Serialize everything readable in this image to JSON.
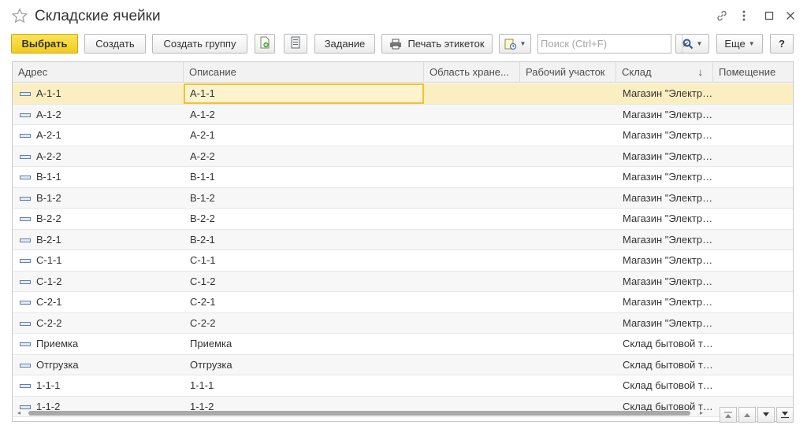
{
  "window": {
    "title": "Складские ячейки"
  },
  "toolbar": {
    "select_label": "Выбрать",
    "create_label": "Создать",
    "create_group_label": "Создать группу",
    "task_label": "Задание",
    "print_labels_label": "Печать этикеток",
    "more_label": "Еще",
    "help_label": "?"
  },
  "search": {
    "placeholder": "Поиск (Ctrl+F)",
    "value": ""
  },
  "table": {
    "columns": [
      {
        "label": "Адрес"
      },
      {
        "label": "Описание"
      },
      {
        "label": "Область хране..."
      },
      {
        "label": "Рабочий участок"
      },
      {
        "label": "Склад"
      },
      {
        "label": "Помещение"
      }
    ],
    "sort_indicator": "↓",
    "rows": [
      {
        "address": "A-1-1",
        "description": "A-1-1",
        "storage_area": "",
        "work_area": "",
        "warehouse": "Магазин \"Электромир\"",
        "room": ""
      },
      {
        "address": "A-1-2",
        "description": "A-1-2",
        "storage_area": "",
        "work_area": "",
        "warehouse": "Магазин \"Электромир\"",
        "room": ""
      },
      {
        "address": "A-2-1",
        "description": "A-2-1",
        "storage_area": "",
        "work_area": "",
        "warehouse": "Магазин \"Электромир\"",
        "room": ""
      },
      {
        "address": "A-2-2",
        "description": "A-2-2",
        "storage_area": "",
        "work_area": "",
        "warehouse": "Магазин \"Электромир\"",
        "room": ""
      },
      {
        "address": "B-1-1",
        "description": "B-1-1",
        "storage_area": "",
        "work_area": "",
        "warehouse": "Магазин \"Электромир\"",
        "room": ""
      },
      {
        "address": "B-1-2",
        "description": "B-1-2",
        "storage_area": "",
        "work_area": "",
        "warehouse": "Магазин \"Электромир\"",
        "room": ""
      },
      {
        "address": "B-2-2",
        "description": "B-2-2",
        "storage_area": "",
        "work_area": "",
        "warehouse": "Магазин \"Электромир\"",
        "room": ""
      },
      {
        "address": "B-2-1",
        "description": "B-2-1",
        "storage_area": "",
        "work_area": "",
        "warehouse": "Магазин \"Электромир\"",
        "room": ""
      },
      {
        "address": "C-1-1",
        "description": "C-1-1",
        "storage_area": "",
        "work_area": "",
        "warehouse": "Магазин \"Электромир\"",
        "room": ""
      },
      {
        "address": "C-1-2",
        "description": "C-1-2",
        "storage_area": "",
        "work_area": "",
        "warehouse": "Магазин \"Электромир\"",
        "room": ""
      },
      {
        "address": "C-2-1",
        "description": "C-2-1",
        "storage_area": "",
        "work_area": "",
        "warehouse": "Магазин \"Электромир\"",
        "room": ""
      },
      {
        "address": "C-2-2",
        "description": "C-2-2",
        "storage_area": "",
        "work_area": "",
        "warehouse": "Магазин \"Электромир\"",
        "room": ""
      },
      {
        "address": "Приемка",
        "description": "Приемка",
        "storage_area": "",
        "work_area": "",
        "warehouse": "Склад бытовой техники",
        "room": ""
      },
      {
        "address": "Отгрузка",
        "description": "Отгрузка",
        "storage_area": "",
        "work_area": "",
        "warehouse": "Склад бытовой техники",
        "room": ""
      },
      {
        "address": "1-1-1",
        "description": "1-1-1",
        "storage_area": "",
        "work_area": "",
        "warehouse": "Склад бытовой техники",
        "room": ""
      },
      {
        "address": "1-1-2",
        "description": "1-1-2",
        "storage_area": "",
        "work_area": "",
        "warehouse": "Склад бытовой техники",
        "room": ""
      }
    ]
  },
  "colors": {
    "primary_button": "#f2cc1c",
    "selected_row": "#fbefc2",
    "active_cell_border": "#f1c232",
    "row_icon": "#5d7fb2"
  },
  "icons": {
    "favorite": "star-icon",
    "link": "link-icon",
    "menu": "more-vertical-icon",
    "minimize": "minimize-icon",
    "close": "close-icon",
    "add_from_list": "add-document-icon",
    "list_settings": "list-icon",
    "print": "printer-icon",
    "report": "report-icon",
    "search": "search-icon",
    "clear": "clear-icon",
    "row": "catalog-item-icon",
    "nav_first": "first-page-icon",
    "nav_up": "page-up-icon",
    "nav_down": "page-down-icon",
    "nav_last": "last-page-icon"
  }
}
